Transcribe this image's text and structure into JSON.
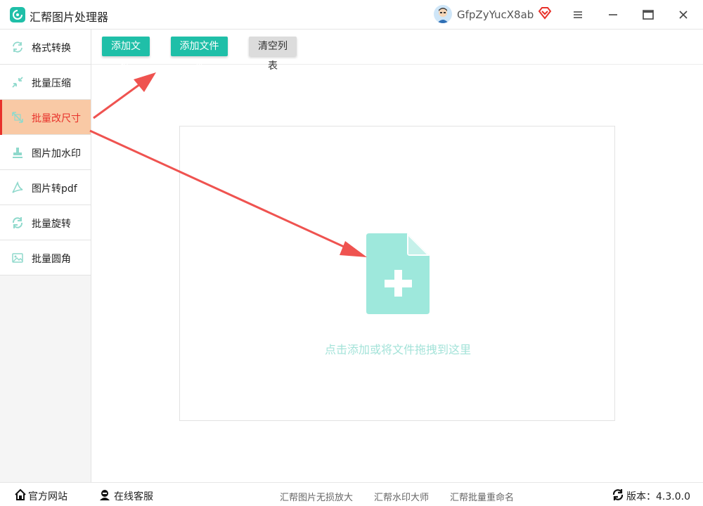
{
  "app": {
    "title": "汇帮图片处理器",
    "username": "GfpZyYucX8ab"
  },
  "sidebar": {
    "items": [
      {
        "label": "格式转换",
        "icon": "format-convert-icon",
        "active": false
      },
      {
        "label": "批量压缩",
        "icon": "compress-icon",
        "active": false
      },
      {
        "label": "批量改尺寸",
        "icon": "resize-icon",
        "active": true
      },
      {
        "label": "图片加水印",
        "icon": "watermark-icon",
        "active": false
      },
      {
        "label": "图片转pdf",
        "icon": "pdf-icon",
        "active": false
      },
      {
        "label": "批量旋转",
        "icon": "rotate-icon",
        "active": false
      },
      {
        "label": "批量圆角",
        "icon": "rounded-corner-icon",
        "active": false
      }
    ]
  },
  "toolbar": {
    "add_file": "添加文件",
    "add_folder": "添加文件夹",
    "clear_list": "清空列表"
  },
  "dropzone": {
    "hint": "点击添加或将文件拖拽到这里"
  },
  "footer": {
    "website": "官方网站",
    "support": "在线客服",
    "links": [
      "汇帮图片无损放大",
      "汇帮水印大师",
      "汇帮批量重命名"
    ],
    "version": "版本：4.3.0.0"
  },
  "colors": {
    "accent": "#1fbfa8",
    "active_bg": "#f9c9a5",
    "active_text": "#e8312a",
    "annotation_arrow": "#ef5350",
    "drop_icon": "#9ee8dc"
  }
}
